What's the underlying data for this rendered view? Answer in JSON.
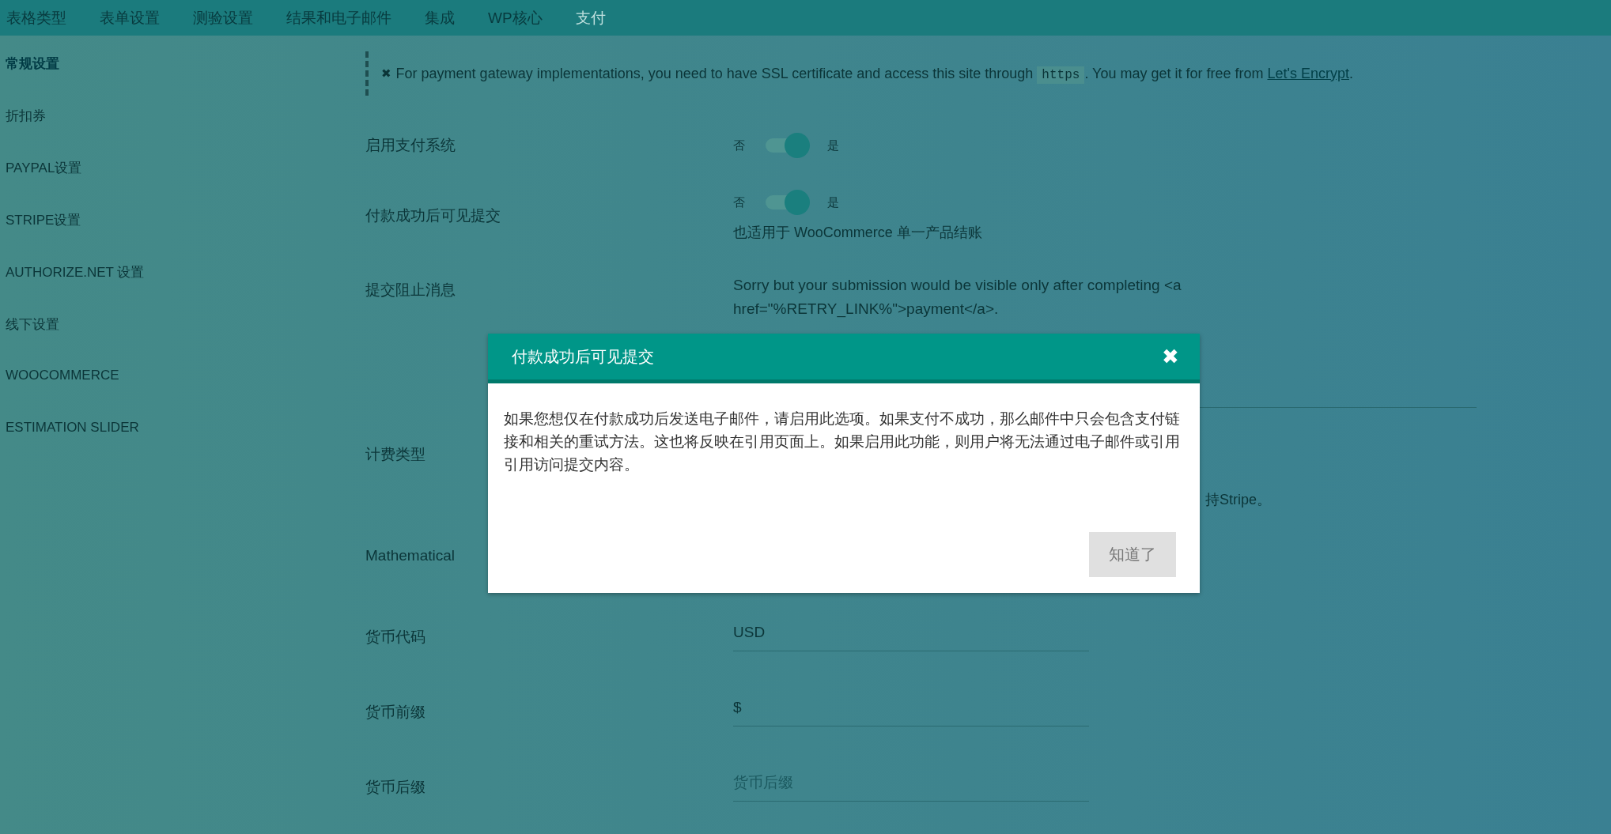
{
  "top_nav": [
    {
      "label": "表格类型",
      "selected": false
    },
    {
      "label": "表单设置",
      "selected": false
    },
    {
      "label": "测验设置",
      "selected": false
    },
    {
      "label": "结果和电子邮件",
      "selected": false
    },
    {
      "label": "集成",
      "selected": false
    },
    {
      "label": "WP核心",
      "selected": false
    },
    {
      "label": "支付",
      "selected": true
    }
  ],
  "sidebar": {
    "items": [
      {
        "label": "常规设置",
        "selected": true
      },
      {
        "label": "折扣券",
        "selected": false
      },
      {
        "label": "PAYPAL设置",
        "selected": false
      },
      {
        "label": "STRIPE设置",
        "selected": false
      },
      {
        "label": "AUTHORIZE.NET 设置",
        "selected": false
      },
      {
        "label": "线下设置",
        "selected": false
      },
      {
        "label": "WOOCOMMERCE",
        "selected": false
      },
      {
        "label": "ESTIMATION SLIDER",
        "selected": false
      }
    ]
  },
  "notice": {
    "icon": "✖",
    "text_before": "For payment gateway implementations, you need to have SSL certificate and access this site through ",
    "code": "https",
    "text_middle": ". You may get it for free from ",
    "link": "Let's Encrypt",
    "text_after": "."
  },
  "settings": [
    {
      "kind": "toggle",
      "label": "启用支付系统",
      "off_label": "否",
      "on_label": "是",
      "on": true
    },
    {
      "kind": "toggle",
      "label": "付款成功后可见提交",
      "off_label": "否",
      "on_label": "是",
      "on": true,
      "help": "也适用于 WooCommerce 单一产品结账"
    },
    {
      "kind": "textarea",
      "label": "提交阻止消息",
      "value": "Sorry but your submission would be visible only after completing <a href=\"%RETRY_LINK%\">payment</a>."
    },
    {
      "kind": "billing",
      "label": "计费类型",
      "note": "持Stripe。"
    },
    {
      "kind": "partial",
      "label": "Mathematical"
    },
    {
      "kind": "text",
      "label": "货币代码",
      "value": "USD"
    },
    {
      "kind": "text",
      "label": "货币前缀",
      "value": "$"
    },
    {
      "kind": "text",
      "label": "货币后缀",
      "placeholder": "货币后缀"
    }
  ],
  "modal": {
    "title": "付款成功后可见提交",
    "close": "✖",
    "body": "如果您想仅在付款成功后发送电子邮件，请启用此选项。如果支付不成功，那么邮件中只会包含支付链接和相关的重试方法。这也将反映在引用页面上。如果启用此功能，则用户将无法通过电子邮件或引用引用访问提交内容。",
    "button": "知道了"
  }
}
